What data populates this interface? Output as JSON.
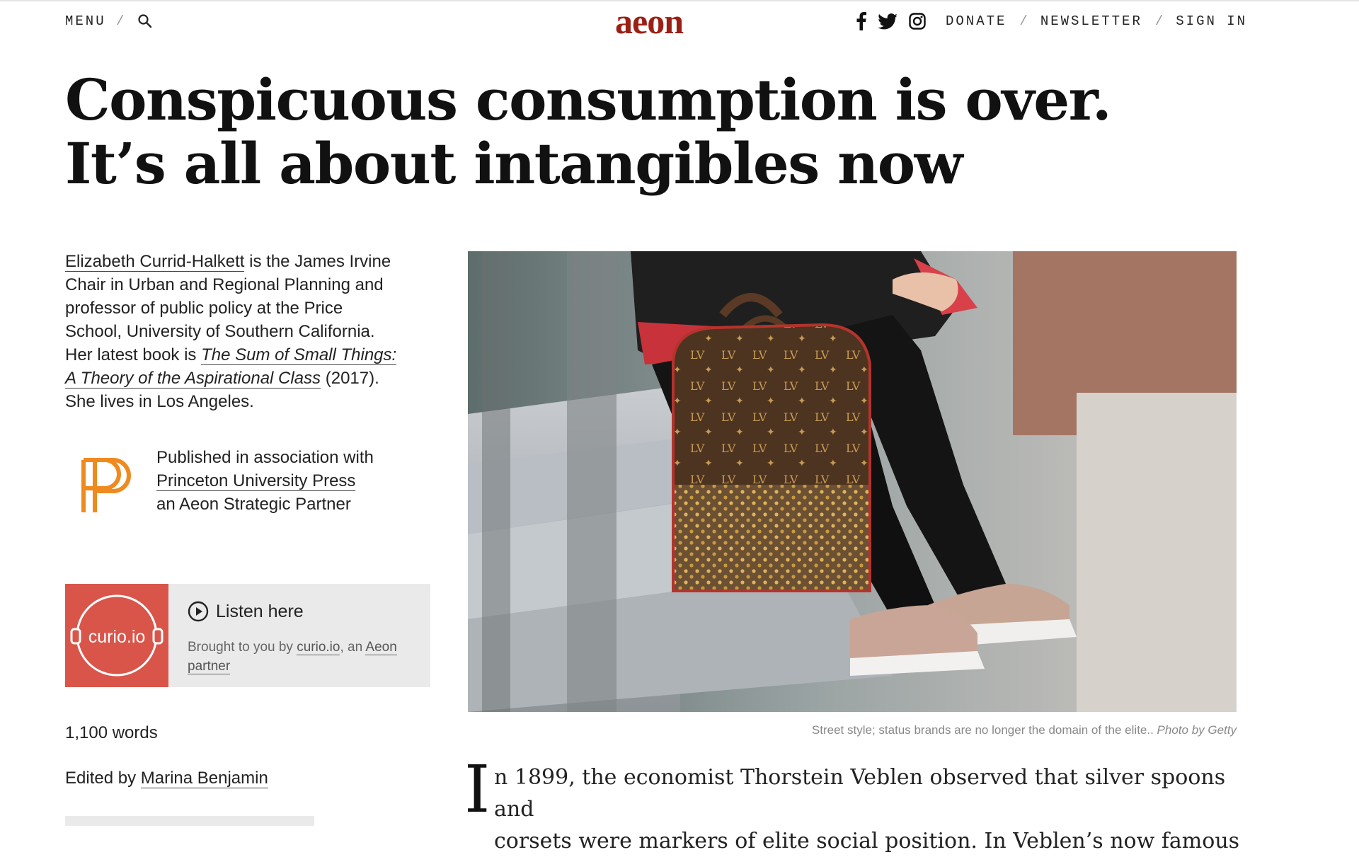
{
  "header": {
    "menu_label": "MENU",
    "logo_text": "aeon",
    "donate_label": "DONATE",
    "newsletter_label": "NEWSLETTER",
    "signin_label": "SIGN IN",
    "separator": "/",
    "icons": [
      "search-icon",
      "facebook-icon",
      "twitter-icon",
      "instagram-icon"
    ]
  },
  "article": {
    "headline_line1": "Conspicuous consumption is over.",
    "headline_line2": "It’s all about intangibles now"
  },
  "author": {
    "name": "Elizabeth Currid-Halkett",
    "bio_1": " is the James Irvine Chair in Urban and Regional Planning and professor of public policy at the Price School, University of Southern California. Her latest book is ",
    "book_title": "The Sum of Small Things: A Theory of the Aspirational Class",
    "bio_2": " (2017). She lives in Los Angeles."
  },
  "partner": {
    "line1": "Published in association with",
    "name": "Princeton University Press",
    "line3": "an Aeon Strategic Partner"
  },
  "audio": {
    "logo_text": "curio.io",
    "listen_label": "Listen here",
    "brought_prefix": "Brought to you by ",
    "brought_link": "curio.io",
    "brought_mid": ", an ",
    "brought_link2": "Aeon",
    "brought_suffix": "partner"
  },
  "meta": {
    "words": "1,100 words",
    "edited_prefix": "Edited by ",
    "editor": "Marina Benjamin"
  },
  "image": {
    "caption": "Street style; status brands are no longer the domain of the elite.. ",
    "credit": "Photo by Getty"
  },
  "body": {
    "dropcap": "I",
    "line1": "n 1899, the economist Thorstein Veblen observed that silver spoons and",
    "line2": "corsets were markers of elite social position. In Veblen’s now famous"
  },
  "colors": {
    "brand": "#9c1f16",
    "curio": "#d9554a",
    "pup_orange": "#ef8a1f"
  }
}
